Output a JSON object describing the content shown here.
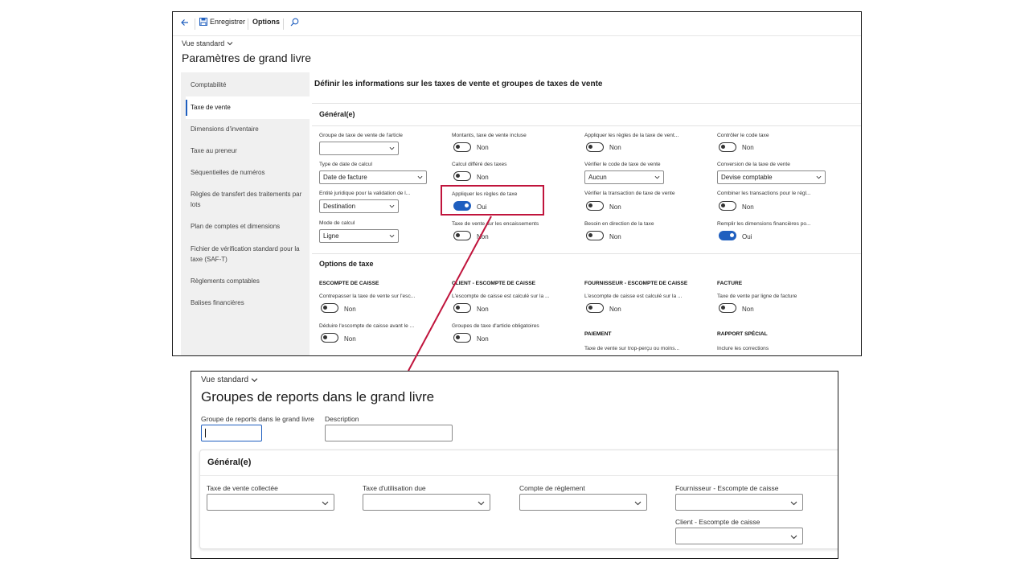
{
  "colors": {
    "accent": "#1f5fbf",
    "highlight": "#c0143c",
    "nav_bg": "#f0f0f0"
  },
  "ledger": {
    "toolbar": {
      "save_label": "Enregistrer",
      "options_label": "Options"
    },
    "view_label": "Vue standard",
    "title": "Paramètres de grand livre",
    "nav_items": [
      "Comptabilité",
      "Taxe de vente",
      "Dimensions d'inventaire",
      "Taxe au preneur",
      "Séquentielles de numéros",
      "Règles de transfert des traitements par lots",
      "Plan de comptes et dimensions",
      "Fichier de vérification standard pour la taxe (SAF-T)",
      "Règlements comptables",
      "Balises financières"
    ],
    "main_heading": "Définir les informations sur les taxes de vente et groupes de taxes de vente",
    "general": {
      "title": "Général(e)",
      "fields": [
        {
          "label": "Groupe de taxe de vente de l'article",
          "value": ""
        },
        {
          "label": "Montants, taxe de vente incluse",
          "value": "Non"
        },
        {
          "label": "Appliquer les règles de la taxe de vent...",
          "value": "Non"
        },
        {
          "label": "Contrôler le code taxe",
          "value": "Non"
        },
        {
          "label": "Type de date de calcul",
          "value": "Date de facture"
        },
        {
          "label": "Calcul différé des taxes",
          "value": "Non"
        },
        {
          "label": "Vérifier le code de taxe de vente",
          "value": "Aucun"
        },
        {
          "label": "Conversion de la taxe de vente",
          "value": "Devise comptable"
        },
        {
          "label": "Entité juridique pour la validation de l...",
          "value": "Destination"
        },
        {
          "label": "Appliquer les règles de taxe",
          "value": "Oui"
        },
        {
          "label": "Vérifier la transaction de taxe de vente",
          "value": "Non"
        },
        {
          "label": "Combiner les transactions pour le régl...",
          "value": "Non"
        },
        {
          "label": "Mode de calcul",
          "value": "Ligne"
        },
        {
          "label": "Taxe de vente sur les encaissements",
          "value": "Non"
        },
        {
          "label": "Besoin en direction de la taxe",
          "value": "Non"
        },
        {
          "label": "Remplir les dimensions financières po...",
          "value": "Oui"
        }
      ]
    },
    "tax_options": {
      "title": "Options de taxe",
      "groups": [
        "ESCOMPTE DE CAISSE",
        "CLIENT - ESCOMPTE DE CAISSE",
        "FOURNISSEUR - ESCOMPTE DE CAISSE",
        "FACTURE",
        "PAIEMENT",
        "RAPPORT SPÉCIAL"
      ],
      "fields": [
        {
          "label": "Contrepasser la taxe de vente sur l'esc...",
          "value": "Non"
        },
        {
          "label": "L'escompte de caisse est calculé sur la ...",
          "value": "Non"
        },
        {
          "label": "L'escompte de caisse est calculé sur la ...",
          "value": "Non"
        },
        {
          "label": "Taxe de vente par ligne de facture",
          "value": "Non"
        },
        {
          "label": "Déduire l'escompte de caisse avant le ...",
          "value": "Non"
        },
        {
          "label": "Groupes de taxe d'article obligatoires",
          "value": "Non"
        },
        {
          "label": "Taxe de vente sur trop-perçu ou moins...",
          "value": ""
        },
        {
          "label": "Inclure les corrections",
          "value": ""
        }
      ]
    }
  },
  "posting": {
    "view_label": "Vue standard",
    "title": "Groupes de reports dans le grand livre",
    "group_label": "Groupe de reports dans le grand livre",
    "description_label": "Description",
    "general_title": "Général(e)",
    "fields": [
      "Taxe de vente collectée",
      "Taxe d'utilisation due",
      "Compte de règlement",
      "Fournisseur - Escompte de caisse",
      "Client - Escompte de caisse"
    ]
  }
}
